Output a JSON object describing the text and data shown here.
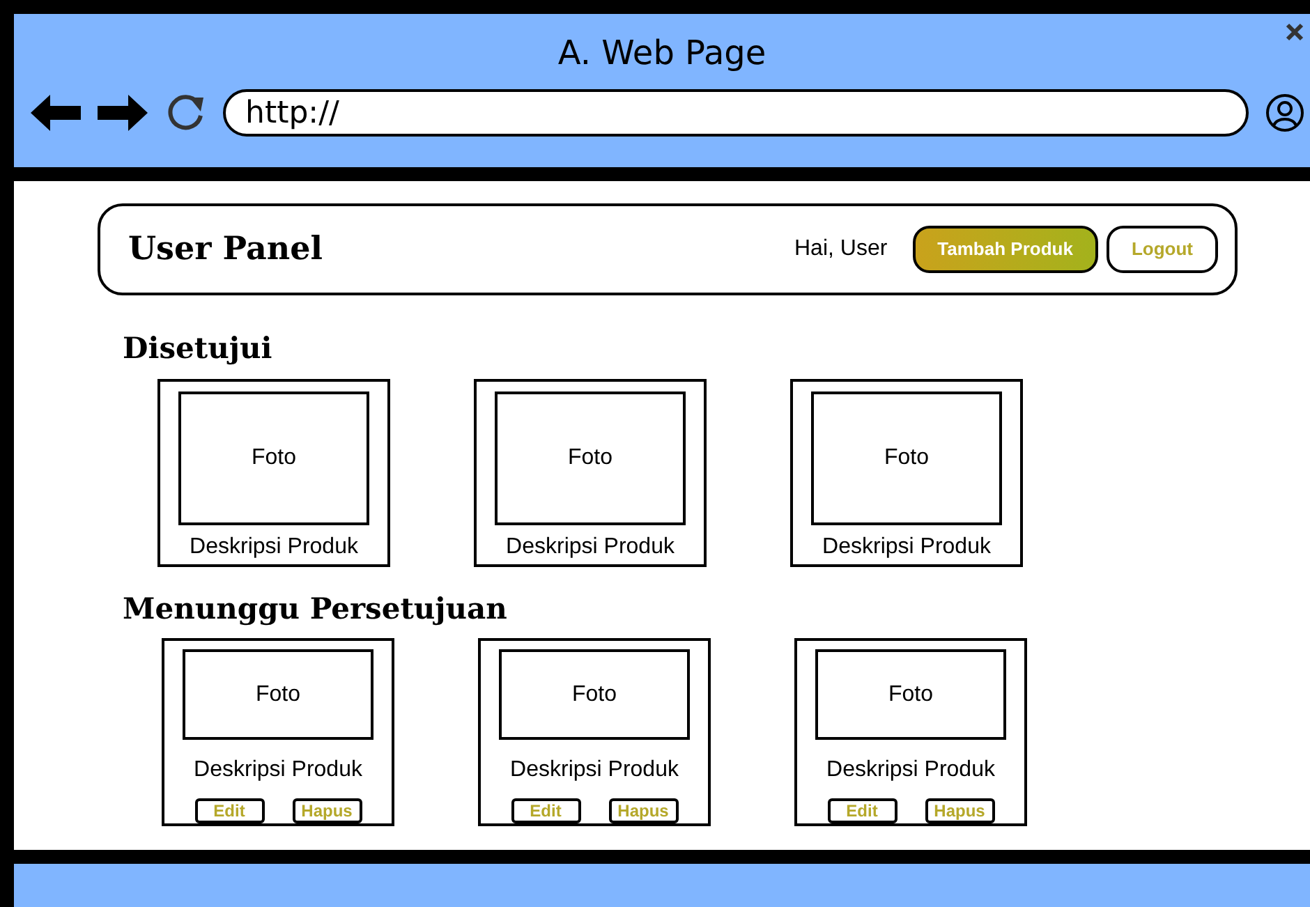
{
  "window": {
    "title": "A. Web Page",
    "url": "http://"
  },
  "header": {
    "title": "User Panel",
    "greeting": "Hai, User",
    "buttons": [
      {
        "label": "Tambah Produk",
        "kind": "primary"
      },
      {
        "label": "Logout",
        "kind": "outline"
      }
    ]
  },
  "sections": [
    {
      "title": "Disetujui",
      "products": [
        {
          "photo": "Foto",
          "description": "Deskripsi Produk"
        },
        {
          "photo": "Foto",
          "description": "Deskripsi Produk"
        },
        {
          "photo": "Foto",
          "description": "Deskripsi Produk"
        }
      ]
    },
    {
      "title": "Menunggu Persetujuan",
      "products": [
        {
          "photo": "Foto",
          "description": "Deskripsi Produk",
          "actions": [
            "Edit",
            "Hapus"
          ]
        },
        {
          "photo": "Foto",
          "description": "Deskripsi Produk",
          "actions": [
            "Edit",
            "Hapus"
          ]
        },
        {
          "photo": "Foto",
          "description": "Deskripsi Produk",
          "actions": [
            "Edit",
            "Hapus"
          ]
        }
      ]
    }
  ]
}
